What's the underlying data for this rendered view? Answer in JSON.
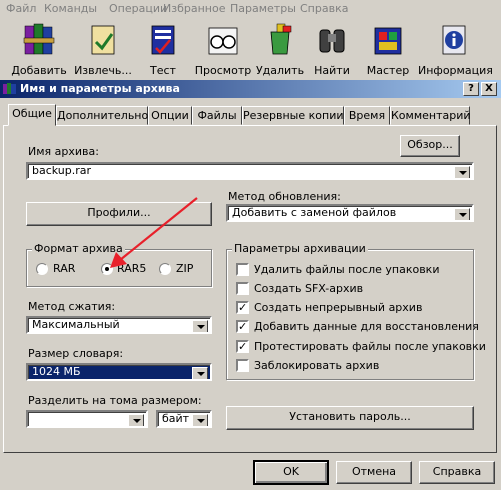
{
  "menu": [
    "Файл",
    "Команды",
    "Операции",
    "Избранное",
    "Параметры",
    "Справка"
  ],
  "toolbar": [
    {
      "label": "Добавить",
      "icon": "books-archive-icon"
    },
    {
      "label": "Извлечь...",
      "icon": "folder-extract-icon"
    },
    {
      "label": "Тест",
      "icon": "test-document-icon"
    },
    {
      "label": "Просмотр",
      "icon": "glasses-view-icon"
    },
    {
      "label": "Удалить",
      "icon": "recycle-bin-icon"
    },
    {
      "label": "Найти",
      "icon": "binoculars-icon"
    },
    {
      "label": "Мастер",
      "icon": "wizard-icon"
    },
    {
      "label": "Информация",
      "icon": "info-icon"
    }
  ],
  "dialog": {
    "title": "Имя и параметры архива",
    "help_btn": "?",
    "close_btn": "X",
    "tabs": [
      "Общие",
      "Дополнительно",
      "Опции",
      "Файлы",
      "Резервные копии",
      "Время",
      "Комментарий"
    ],
    "active_tab": "Общие",
    "archive_name_label": "Имя архива:",
    "archive_name_value": "backup.rar",
    "browse_btn": "Обзор...",
    "profiles_btn": "Профили...",
    "update_method_label": "Метод обновления:",
    "update_method_value": "Добавить с заменой файлов",
    "format_label": "Формат архива",
    "formats": [
      "RAR",
      "RAR5",
      "ZIP"
    ],
    "selected_format": "RAR5",
    "compression_label": "Метод сжатия:",
    "compression_value": "Максимальный",
    "dict_label": "Размер словаря:",
    "dict_value": "1024 МБ",
    "split_label": "Разделить на тома размером:",
    "split_value": "",
    "split_unit": "байт",
    "archiving_params_label": "Параметры архивации",
    "options": [
      {
        "label": "Удалить файлы после упаковки",
        "checked": false
      },
      {
        "label": "Создать SFX-архив",
        "checked": false
      },
      {
        "label": "Создать непрерывный архив",
        "checked": true
      },
      {
        "label": "Добавить данные для восстановления",
        "checked": true
      },
      {
        "label": "Протестировать файлы после упаковки",
        "checked": true
      },
      {
        "label": "Заблокировать архив",
        "checked": false
      }
    ],
    "password_btn": "Установить пароль...",
    "ok_btn": "OK",
    "cancel_btn": "Отмена",
    "help_bottom_btn": "Справка"
  },
  "colors": {
    "titlebar": "#0a246a",
    "arrow": "#e8202a",
    "face": "#d4d0c8"
  }
}
